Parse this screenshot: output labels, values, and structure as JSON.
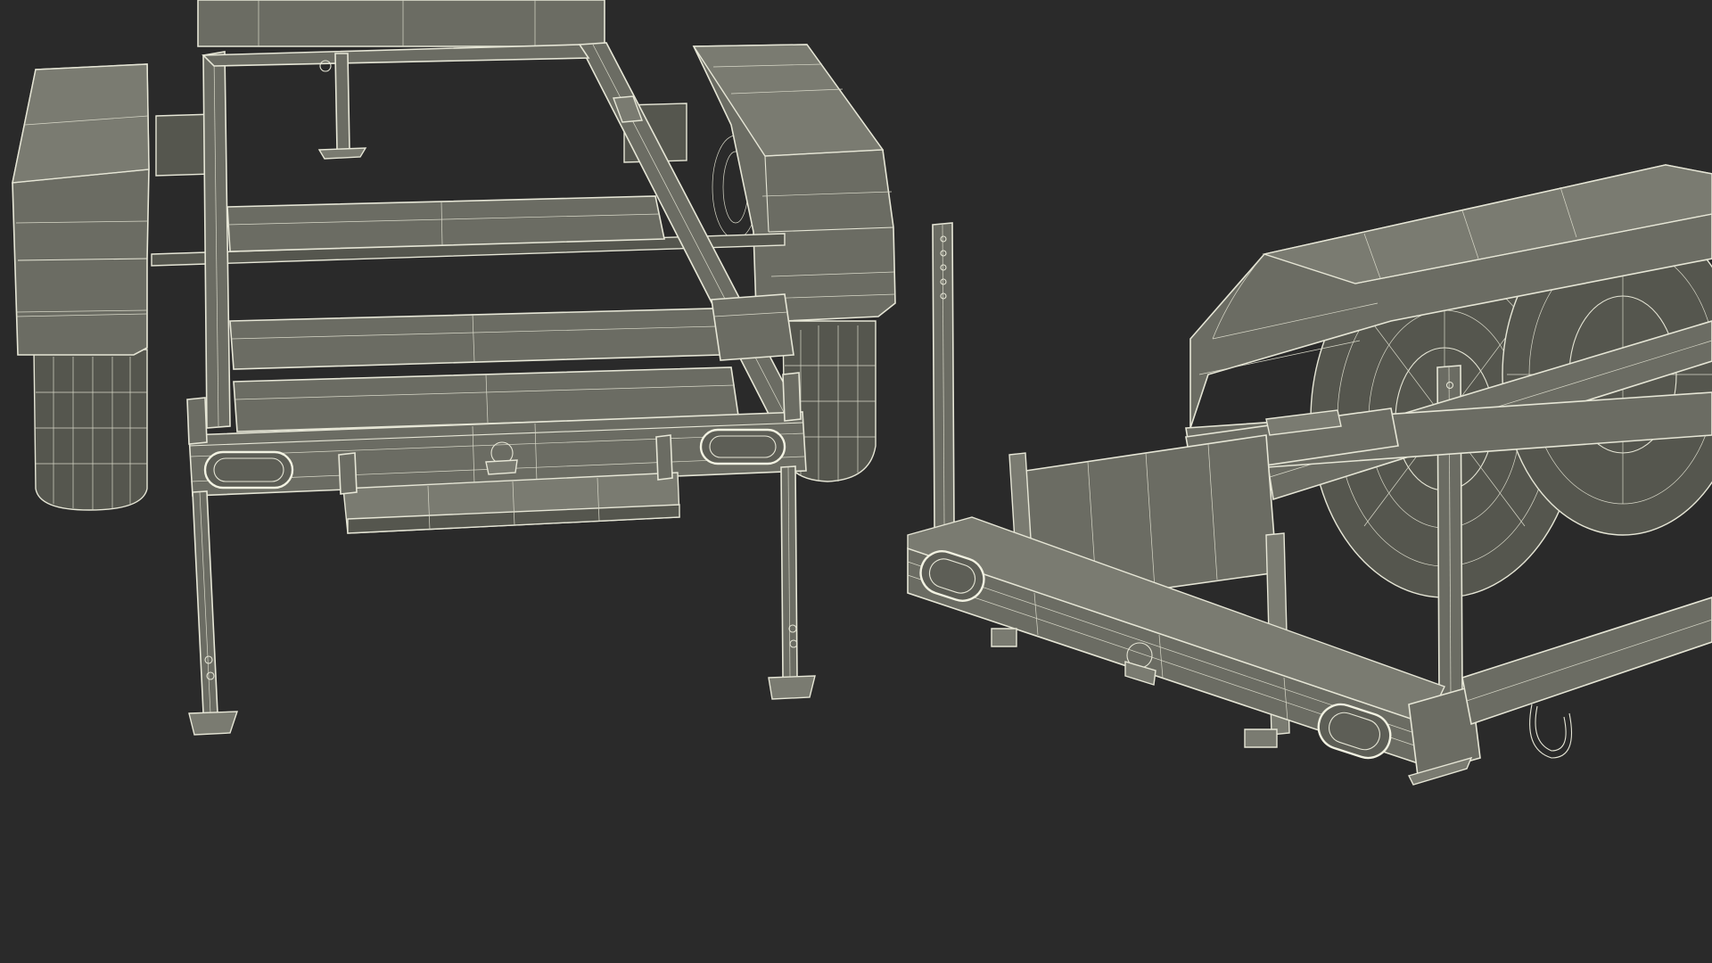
{
  "scene": {
    "subject": "two-utility-trailers-wireframe",
    "background_color": "#2a2a2a",
    "surface_color": "#6b6c63",
    "wire_color": "#e6e6d6"
  }
}
